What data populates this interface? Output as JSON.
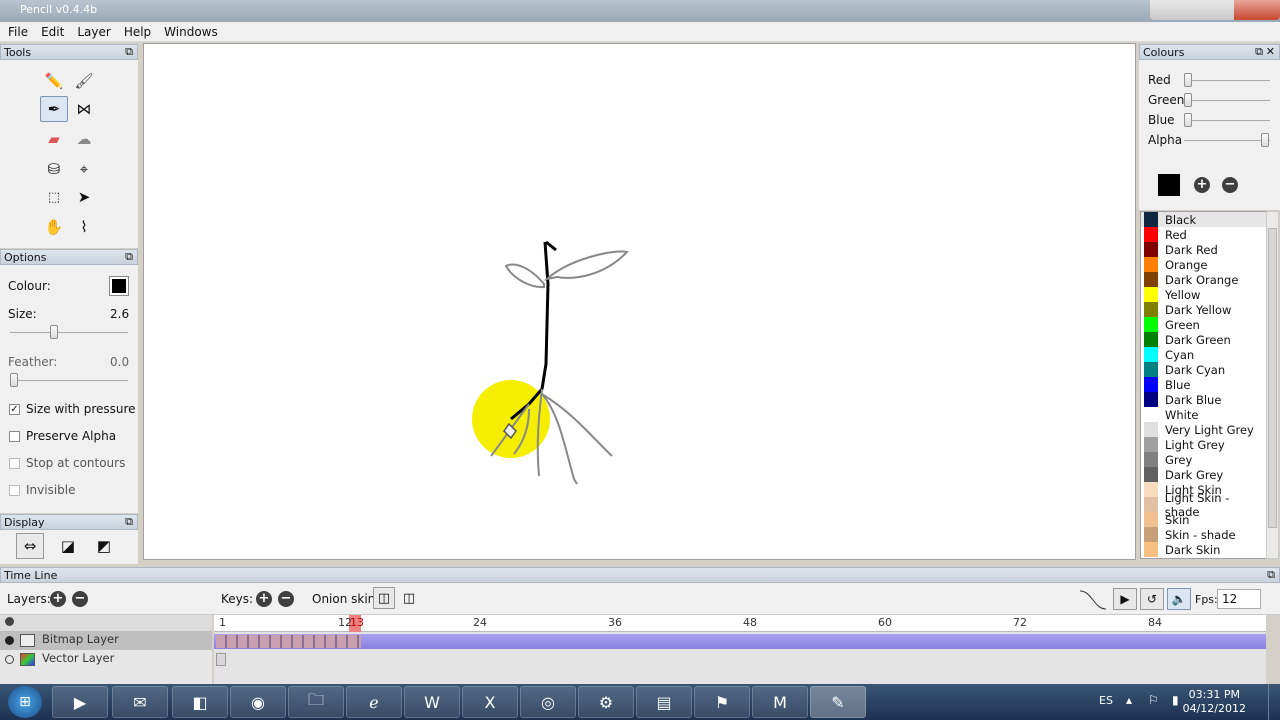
{
  "window": {
    "title": "Pencil v0.4.4b"
  },
  "menu": [
    "File",
    "Edit",
    "Layer",
    "Help",
    "Windows"
  ],
  "tools_panel": {
    "title": "Tools"
  },
  "options_panel": {
    "title": "Options",
    "colour_label": "Colour:",
    "size_label": "Size:",
    "size_value": "2.6",
    "feather_label": "Feather:",
    "feather_value": "0.0",
    "size_with_pressure": "Size with pressure",
    "preserve_alpha": "Preserve Alpha",
    "stop_at_contours": "Stop at contours",
    "invisible": "Invisible"
  },
  "display_panel": {
    "title": "Display"
  },
  "colours_panel": {
    "title": "Colours",
    "red": "Red",
    "green": "Green",
    "blue": "Blue",
    "alpha": "Alpha",
    "current_colour": "#000000",
    "palette": [
      {
        "name": "Black",
        "color": "#0f2740"
      },
      {
        "name": "Red",
        "color": "#ff0000"
      },
      {
        "name": "Dark Red",
        "color": "#800000"
      },
      {
        "name": "Orange",
        "color": "#ff8000"
      },
      {
        "name": "Dark Orange",
        "color": "#804000"
      },
      {
        "name": "Yellow",
        "color": "#ffff00"
      },
      {
        "name": "Dark Yellow",
        "color": "#808000"
      },
      {
        "name": "Green",
        "color": "#00ff00"
      },
      {
        "name": "Dark Green",
        "color": "#008000"
      },
      {
        "name": "Cyan",
        "color": "#00ffff"
      },
      {
        "name": "Dark Cyan",
        "color": "#008080"
      },
      {
        "name": "Blue",
        "color": "#0000ff"
      },
      {
        "name": "Dark Blue",
        "color": "#000080"
      },
      {
        "name": "White",
        "color": "#ffffff"
      },
      {
        "name": "Very Light Grey",
        "color": "#e0e0e0"
      },
      {
        "name": "Light Grey",
        "color": "#a0a0a0"
      },
      {
        "name": "Grey",
        "color": "#808080"
      },
      {
        "name": "Dark Grey",
        "color": "#606060"
      },
      {
        "name": "Light Skin",
        "color": "#f8dcc0"
      },
      {
        "name": "Light Skin - shade",
        "color": "#e0c0a0"
      },
      {
        "name": "Skin",
        "color": "#f0c090"
      },
      {
        "name": "Skin - shade",
        "color": "#c8a078"
      },
      {
        "name": "Dark Skin",
        "color": "#f8c080"
      }
    ]
  },
  "timeline": {
    "title": "Time Line",
    "layers_label": "Layers:",
    "keys_label": "Keys:",
    "onion_label": "Onion skin:",
    "fps_label": "Fps:",
    "fps_value": "12",
    "current_frame": "13",
    "ruler": [
      "1",
      "12",
      "24",
      "36",
      "48",
      "60",
      "72",
      "84"
    ],
    "layers": [
      "Bitmap Layer",
      "Vector Layer"
    ]
  },
  "taskbar": {
    "lang": "ES",
    "time": "03:31 PM",
    "date": "04/12/2012"
  }
}
